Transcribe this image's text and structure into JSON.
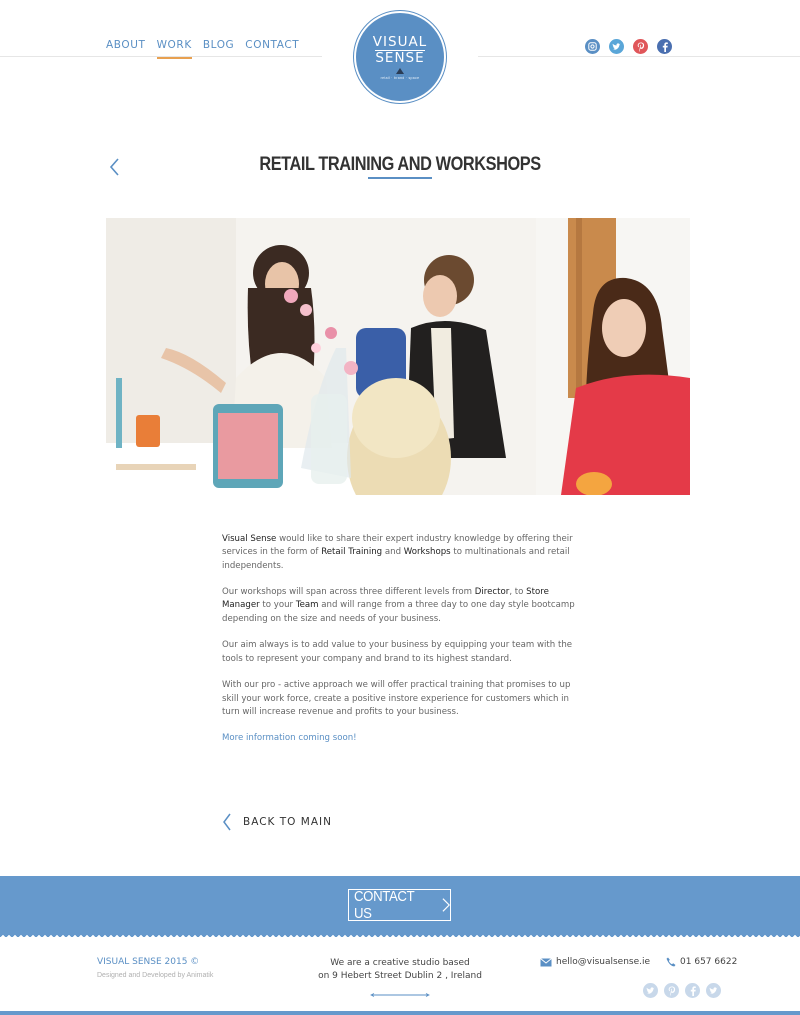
{
  "nav": {
    "about": "ABOUT",
    "work": "WORK",
    "blog": "BLOG",
    "contact": "CONTACT"
  },
  "logo": {
    "line1": "VISUAL",
    "line2": "SENSE",
    "tagline": "retail · brand · space"
  },
  "social": {
    "instagram": "instagram-icon",
    "twitter": "twitter-icon",
    "pinterest": "pinterest-icon",
    "facebook": "facebook-icon"
  },
  "page": {
    "title": "RETAIL TRAINING AND WORKSHOPS"
  },
  "content": {
    "p1": {
      "a": "Visual Sense",
      "b": " would like to share their expert industry knowledge by offering their services in the form of ",
      "c": "Retail Training",
      "d": " and ",
      "e": "Workshops",
      "f": " to multinationals and retail independents."
    },
    "p2": {
      "a": "Our workshops will span across three different levels from ",
      "b": "Director",
      "c": ", to ",
      "d": "Store Manager",
      "e": " to your ",
      "f": "Team",
      "g": " and will range from a three day to one day style bootcamp depending on the size and needs of your business."
    },
    "p3": "Our aim always is to add value to your business by equipping your team with the tools to represent your company and brand to its highest standard.",
    "p4": "With our pro - active approach we will offer practical training that promises to up skill your work force, create a positive instore experience for customers which in turn will increase revenue and profits to your business.",
    "more": "More information coming soon!"
  },
  "back_main": "BACK TO MAIN",
  "contact_us": "CONTACT US",
  "footer": {
    "brand": "VISUAL SENSE 2015 ©",
    "credit": "Designed and Developed by Animatik",
    "line1": "We are a creative studio based",
    "line2": "on 9 Hebert Street Dublin 2 , Ireland",
    "email": "hello@visualsense.ie",
    "phone": "01 657 6622"
  },
  "colors": {
    "accent": "#5a8fc4",
    "band": "#6699cc",
    "active_underline": "#e8a050"
  }
}
